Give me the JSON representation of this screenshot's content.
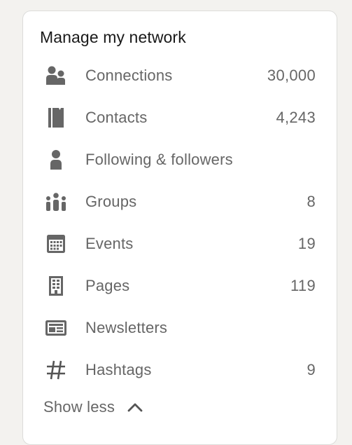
{
  "card": {
    "title": "Manage my network"
  },
  "items": [
    {
      "label": "Connections",
      "count": "30,000",
      "icon": "people-icon"
    },
    {
      "label": "Contacts",
      "count": "4,243",
      "icon": "address-book-icon"
    },
    {
      "label": "Following & followers",
      "count": "",
      "icon": "person-icon"
    },
    {
      "label": "Groups",
      "count": "8",
      "icon": "group-icon"
    },
    {
      "label": "Events",
      "count": "19",
      "icon": "calendar-icon"
    },
    {
      "label": "Pages",
      "count": "119",
      "icon": "building-icon"
    },
    {
      "label": "Newsletters",
      "count": "",
      "icon": "newsletter-icon"
    },
    {
      "label": "Hashtags",
      "count": "9",
      "icon": "hashtag-icon"
    }
  ],
  "footer": {
    "show_less_label": "Show less",
    "chevron_icon": "chevron-up-icon"
  },
  "colors": {
    "background": "#f3f2ef",
    "card": "#ffffff",
    "title_text": "#191919",
    "muted_text": "#666666",
    "icon": "#666666"
  }
}
